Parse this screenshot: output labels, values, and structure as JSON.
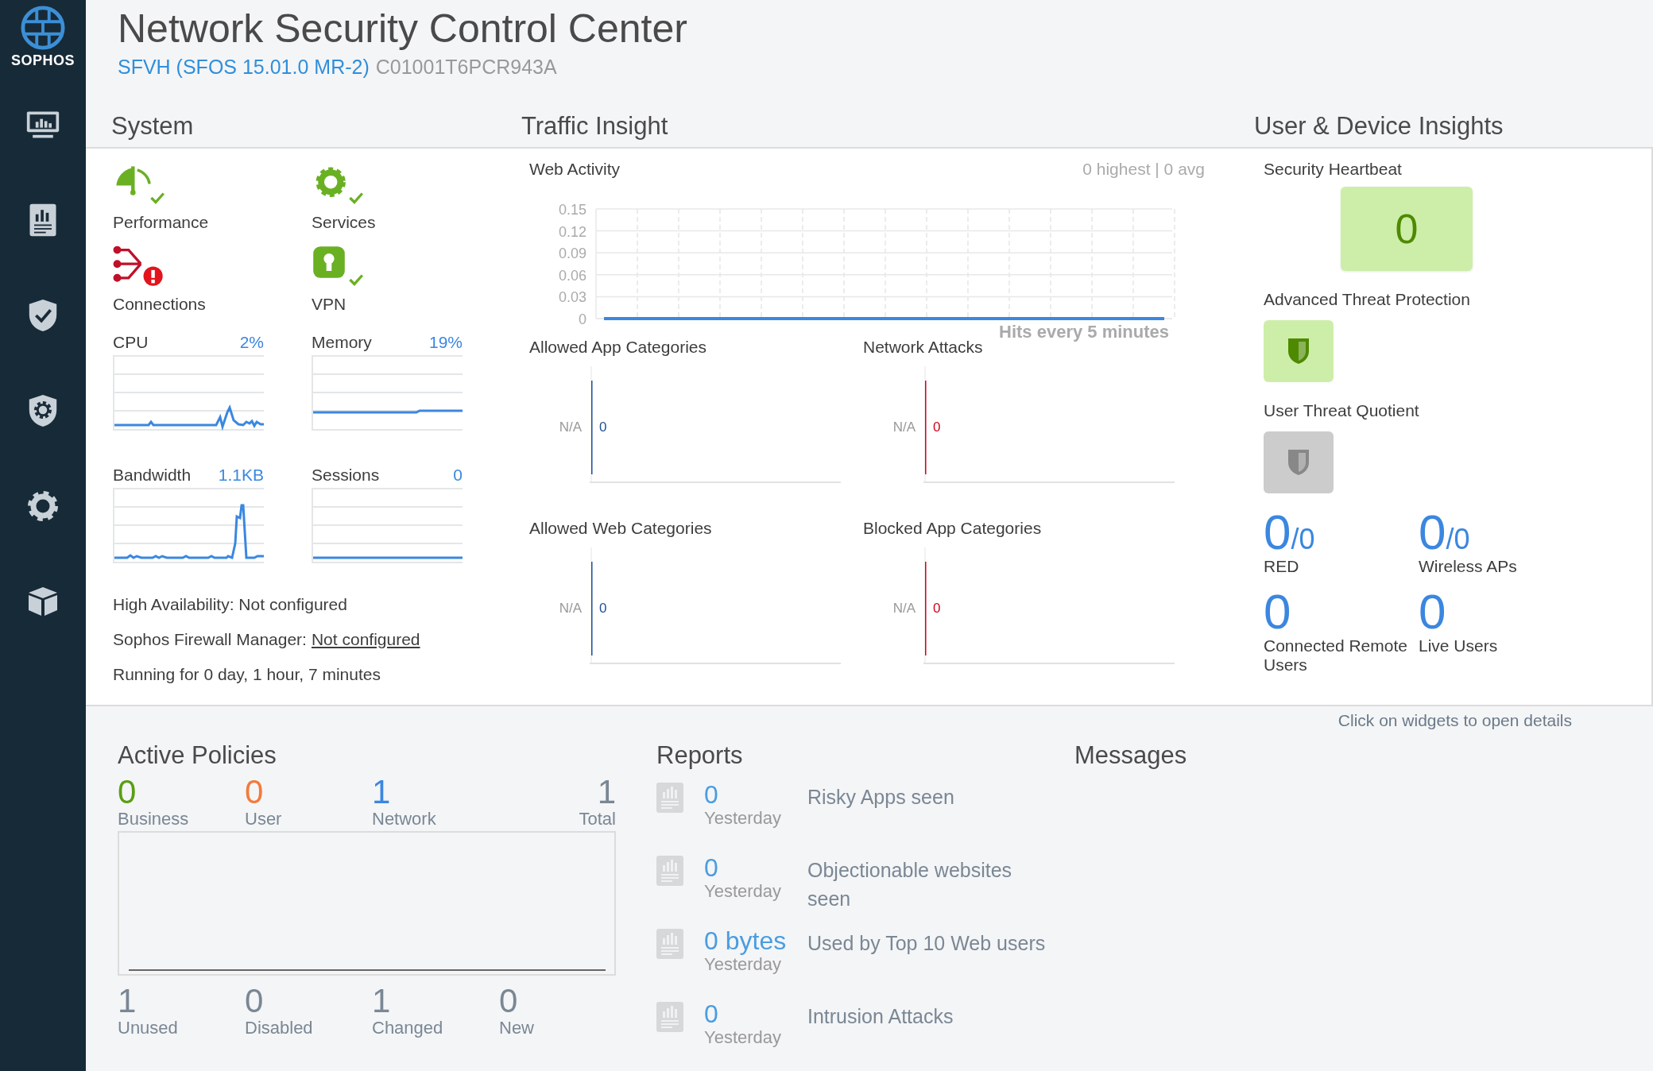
{
  "sidebar": {
    "logo_text": "SOPHOS"
  },
  "header": {
    "title": "Network Security Control Center",
    "model": "SFVH (SFOS 15.01.0 MR-2)",
    "serial": "C01001T6PCR943A"
  },
  "system": {
    "heading": "System",
    "status_items": [
      {
        "label": "Performance",
        "alert": false
      },
      {
        "label": "Services",
        "alert": false
      },
      {
        "label": "Connections",
        "alert": true
      },
      {
        "label": "VPN",
        "alert": false
      }
    ],
    "meters": [
      {
        "label": "CPU",
        "value": "2%"
      },
      {
        "label": "Memory",
        "value": "19%"
      },
      {
        "label": "Bandwidth",
        "value": "1.1KB"
      },
      {
        "label": "Sessions",
        "value": "0"
      }
    ],
    "info": [
      {
        "text": "High Availability: Not configured"
      },
      {
        "text": "Sophos Firewall Manager:",
        "link": "Not configured"
      },
      {
        "text": "Running for 0 day, 1 hour, 7 minutes"
      }
    ]
  },
  "traffic": {
    "heading": "Traffic Insight",
    "web_activity": {
      "summary": "0 highest | 0 avg",
      "chart_data": {
        "type": "line",
        "grid": true,
        "title": "Web Activity",
        "xlabel": "Hits every 5 minutes",
        "ylim": [
          0,
          0.15
        ],
        "yticks": [
          0,
          0.03,
          0.06,
          0.09,
          0.12,
          0.15
        ],
        "series": [
          {
            "color": "#3b87e0",
            "values": [
              0,
              0,
              0,
              0,
              0,
              0,
              0,
              0,
              0,
              0,
              0,
              0,
              0,
              0,
              0,
              0,
              0
            ]
          }
        ]
      }
    },
    "category_charts": [
      {
        "title": "Allowed App Categories",
        "category": "N/A",
        "value": "0",
        "color": "#1f4e96"
      },
      {
        "title": "Network Attacks",
        "category": "N/A",
        "value": "0",
        "color": "#d0021b"
      },
      {
        "title": "Allowed Web Categories",
        "category": "N/A",
        "value": "0",
        "color": "#1f4e96"
      },
      {
        "title": "Blocked App Categories",
        "category": "N/A",
        "value": "0",
        "color": "#d0021b"
      }
    ]
  },
  "user": {
    "heading": "User & Device Insights",
    "heartbeat": {
      "label": "Security Heartbeat",
      "value": "0",
      "active": true
    },
    "tiles": [
      {
        "label": "Advanced Threat Protection",
        "active": true
      },
      {
        "label": "User Threat Quotient",
        "active": false
      }
    ],
    "counters": [
      {
        "value": "0",
        "total": "/0",
        "label": "RED"
      },
      {
        "value": "0",
        "total": "/0",
        "label": "Wireless APs"
      },
      {
        "value": "0",
        "label": "Connected Remote Users"
      },
      {
        "value": "0",
        "label": "Live Users"
      }
    ]
  },
  "hint": "Click on widgets to open details",
  "policies": {
    "heading": "Active Policies",
    "counts": [
      {
        "value": "0",
        "label": "Business",
        "color": "#5a9e12"
      },
      {
        "value": "0",
        "label": "User",
        "color": "#f47a3a"
      },
      {
        "value": "1",
        "label": "Network",
        "color": "#3b87e0"
      },
      {
        "value": "1",
        "label": "Total",
        "color": "#7a8794"
      }
    ],
    "stats": [
      {
        "value": "1",
        "label": "Unused"
      },
      {
        "value": "0",
        "label": "Disabled"
      },
      {
        "value": "1",
        "label": "Changed"
      },
      {
        "value": "0",
        "label": "New"
      }
    ]
  },
  "reports": {
    "heading": "Reports",
    "items": [
      {
        "value": "0",
        "period": "Yesterday",
        "description": "Risky Apps seen"
      },
      {
        "value": "0",
        "period": "Yesterday",
        "description": "Objectionable websites seen"
      },
      {
        "value": "0 bytes",
        "period": "Yesterday",
        "description": "Used by Top 10 Web users"
      },
      {
        "value": "0",
        "period": "Yesterday",
        "description": "Intrusion Attacks"
      }
    ]
  },
  "messages": {
    "heading": "Messages"
  }
}
